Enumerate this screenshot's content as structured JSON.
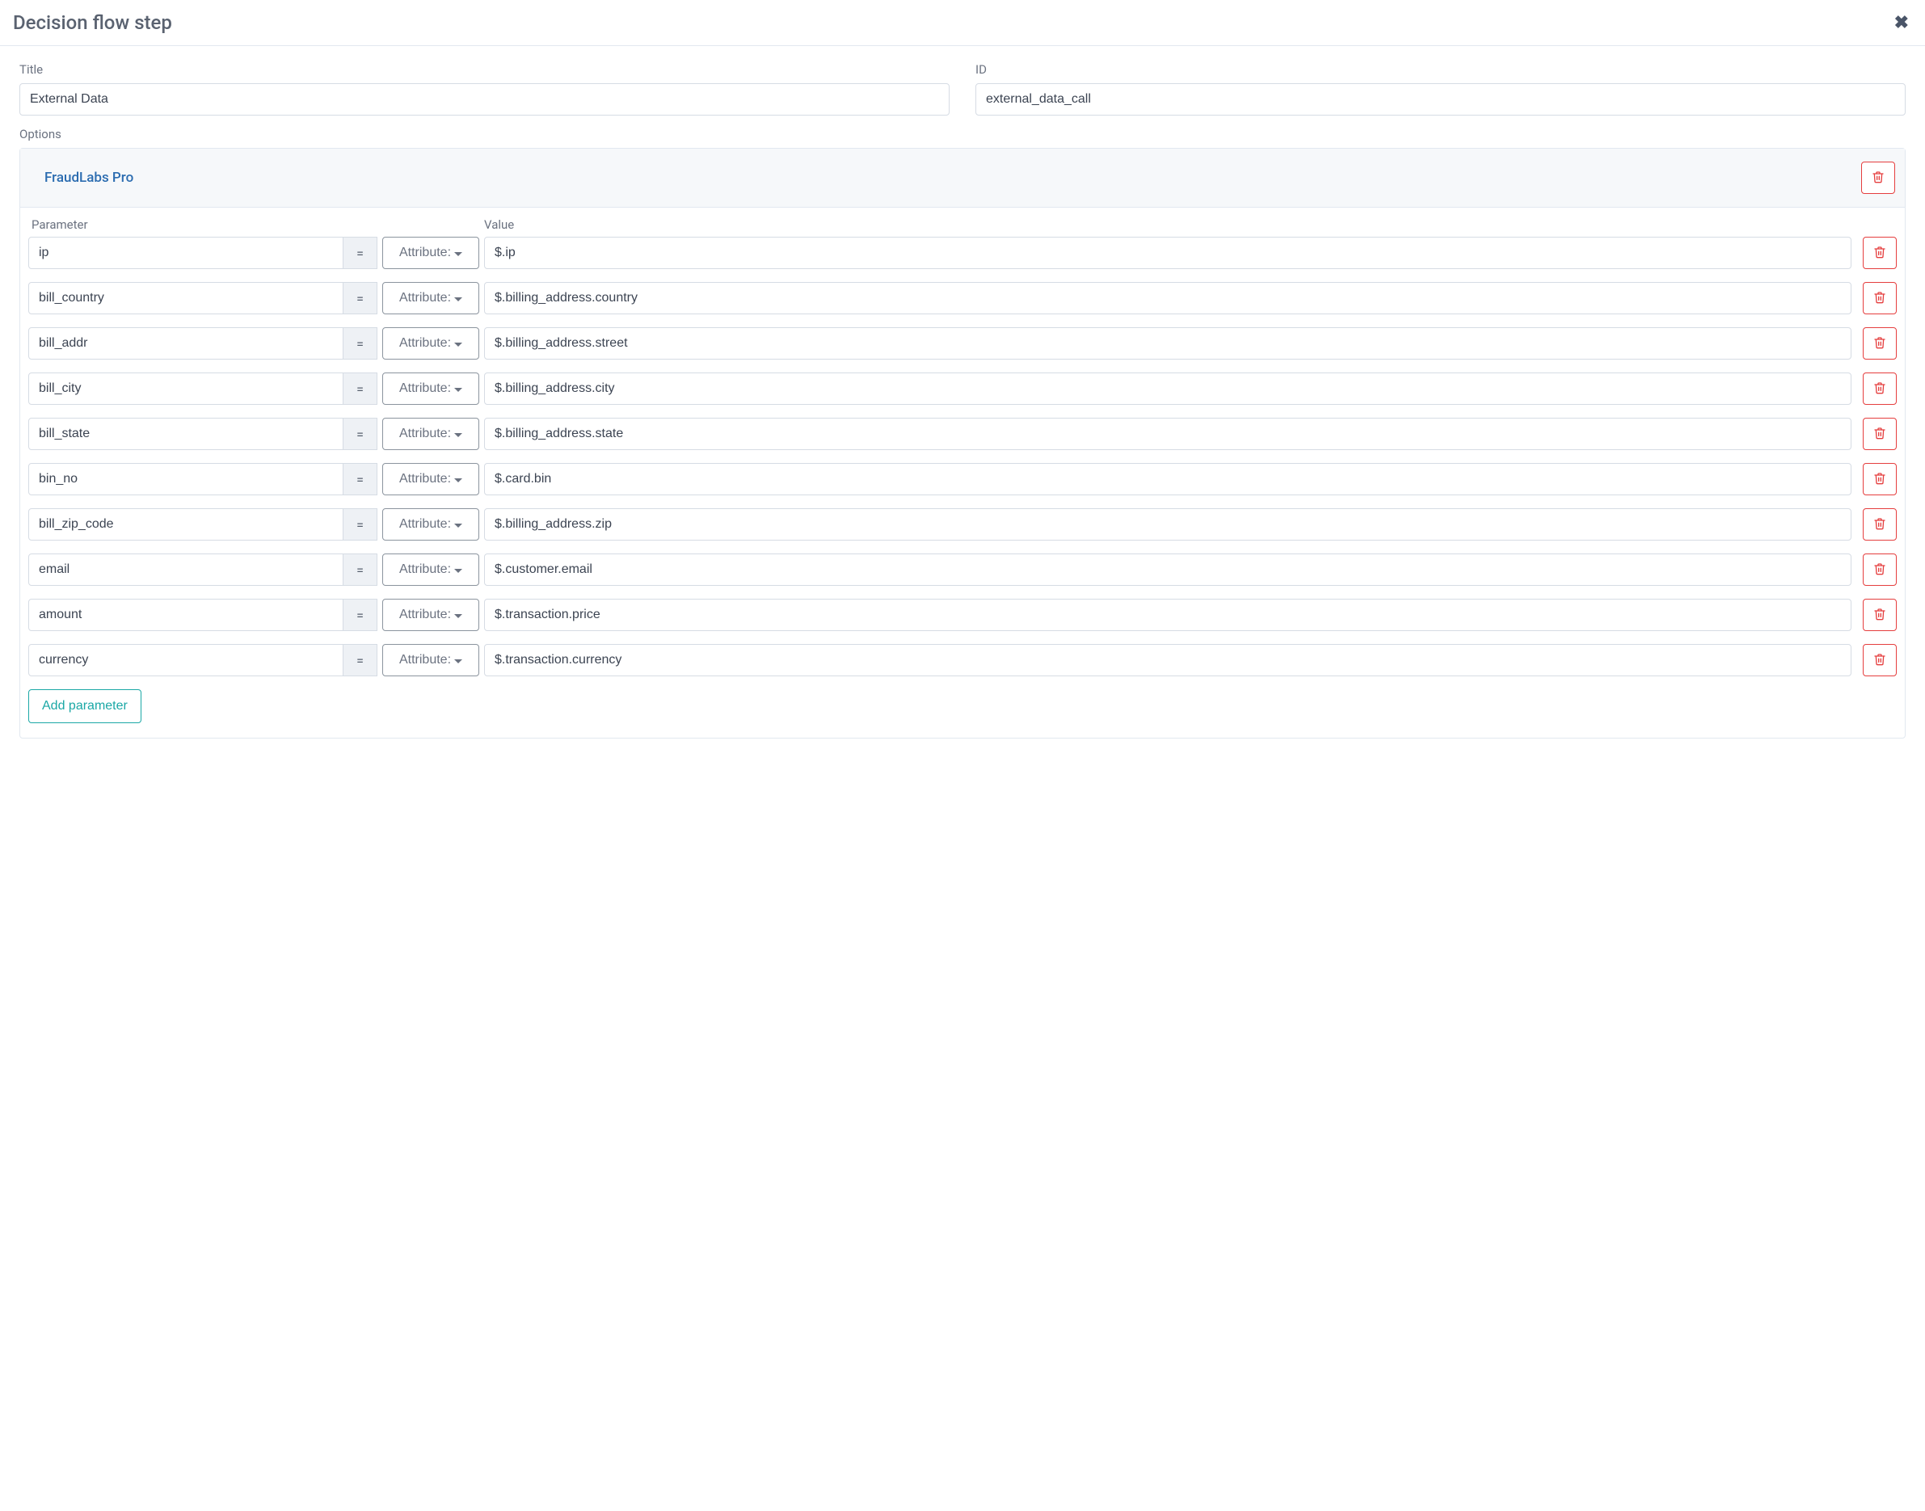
{
  "header": {
    "title": "Decision flow step"
  },
  "fields": {
    "title_label": "Title",
    "title_value": "External Data",
    "id_label": "ID",
    "id_value": "external_data_call",
    "options_label": "Options"
  },
  "option": {
    "name": "FraudLabs Pro",
    "columns": {
      "parameter": "Parameter",
      "value": "Value"
    },
    "eq_symbol": "=",
    "attribute_label": "Attribute:",
    "rows": [
      {
        "param": "ip",
        "value": "$.ip"
      },
      {
        "param": "bill_country",
        "value": "$.billing_address.country"
      },
      {
        "param": "bill_addr",
        "value": "$.billing_address.street"
      },
      {
        "param": "bill_city",
        "value": "$.billing_address.city"
      },
      {
        "param": "bill_state",
        "value": "$.billing_address.state"
      },
      {
        "param": "bin_no",
        "value": "$.card.bin"
      },
      {
        "param": "bill_zip_code",
        "value": "$.billing_address.zip"
      },
      {
        "param": "email",
        "value": "$.customer.email"
      },
      {
        "param": "amount",
        "value": "$.transaction.price"
      },
      {
        "param": "currency",
        "value": "$.transaction.currency"
      }
    ],
    "add_parameter_label": "Add parameter"
  }
}
